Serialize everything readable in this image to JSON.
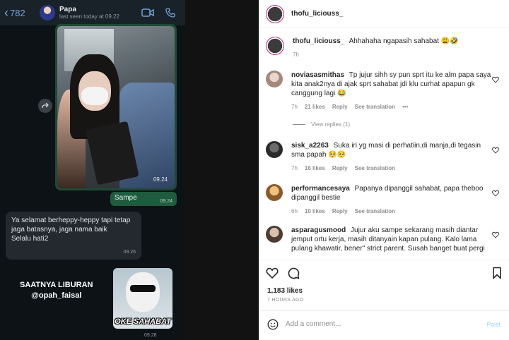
{
  "chat": {
    "back_count": "782",
    "contact_name": "Papa",
    "last_seen": "last seen today at 09.22",
    "photo_time": "09.24",
    "out_message": "Sampe",
    "out_time": "09.24",
    "in_message": "Ya selamat berheppy-heppy tapi tetap jaga batasnya, jaga nama baik\nSelalu hati2",
    "in_time": "09.26",
    "caption_line1": "SAATNYA LIBURAN",
    "caption_line2": "@opah_faisal",
    "sticker_label": "OKE SAHABAT",
    "bottom_time": "09.28"
  },
  "instagram": {
    "username": "thofu_liciouss_",
    "caption": {
      "user": "thofu_liciouss_",
      "text": "Ahhahaha ngapasih sahabat 😩🤣",
      "time": "7h"
    },
    "comments": [
      {
        "user": "noviasasmithas",
        "text": "Tp jujur sihh sy pun sprt itu ke alm papa saya kita anak2nya di ajak sprt sahabat jdi klu curhat apapun gk canggung lagi 😂",
        "time": "7h",
        "likes": "21 likes",
        "reply": "Reply",
        "translation": "See translation",
        "more": "•••"
      },
      {
        "user": "sisk_a2263",
        "text": "Suka iri yg masi di perhatiin,di manja,di tegasin sma papah 🥺🥺",
        "time": "7h",
        "likes": "16 likes",
        "reply": "Reply",
        "translation": "See translation"
      },
      {
        "user": "performancesaya",
        "text": "Papanya dipanggil sahabat, papa theboo dipanggil bestie",
        "time": "6h",
        "likes": "10 likes",
        "reply": "Reply",
        "translation": "See translation"
      },
      {
        "user": "asparagusmood",
        "text": "Jujur aku sampe sekarang masih diantar jemput ortu kerja, masih ditanyain kapan pulang. Kalo lama pulang khawatir, bener\" strict parent. Susah banget buat pergi",
        "time": "",
        "likes": "",
        "reply": "",
        "translation": ""
      }
    ],
    "view_replies": "View replies (1)",
    "likes_total": "1,183 likes",
    "posted_ago": "7 HOURS AGO",
    "add_comment_placeholder": "Add a comment...",
    "post_label": "Post"
  }
}
